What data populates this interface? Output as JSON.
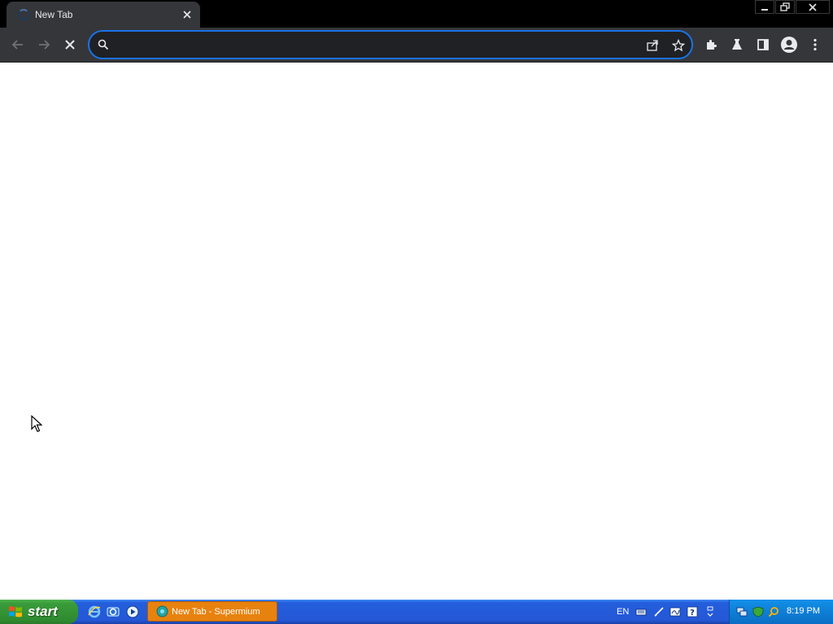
{
  "browser": {
    "tab": {
      "title": "New Tab"
    },
    "omnibox": {
      "value": "",
      "placeholder": ""
    },
    "icons": {
      "back": "arrow-left-icon",
      "forward": "arrow-right-icon",
      "stop": "close-icon",
      "search": "search-icon",
      "share": "share-icon",
      "bookmark": "star-icon",
      "extensions": "puzzle-icon",
      "labs": "flask-icon",
      "side_panel": "side-panel-icon",
      "profile": "profile-icon",
      "menu": "kebab-menu-icon"
    },
    "colors": {
      "accent": "#1a73e8",
      "toolbar": "#35363a",
      "titlebar": "#000000"
    }
  },
  "taskbar": {
    "start_label": "start",
    "active_window": "New Tab - Supermium",
    "language": "EN",
    "clock": "8:19 PM"
  }
}
